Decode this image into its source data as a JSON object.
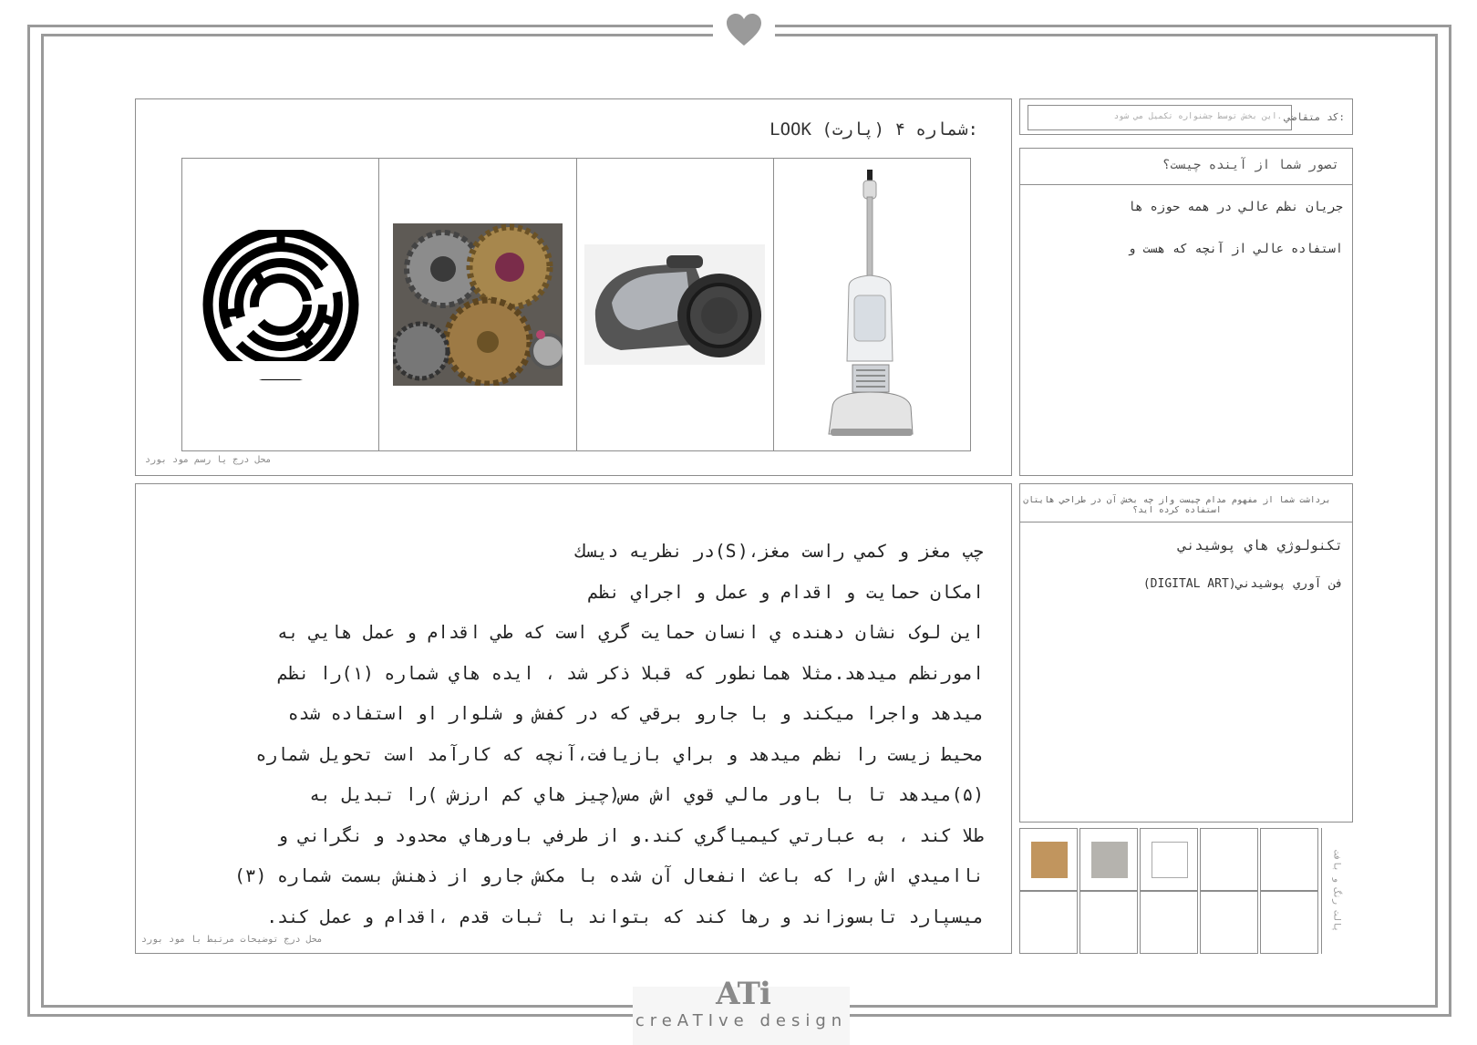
{
  "look_board": {
    "title": "LOOK (پارت) شماره ۴:",
    "note": "محل درج يا رسم مود بورد",
    "images": [
      {
        "name": "maze"
      },
      {
        "name": "gears"
      },
      {
        "name": "canister-vacuum"
      },
      {
        "name": "upright-vacuum"
      }
    ]
  },
  "description": {
    "lines": [
      "چپ مغز و كمي راست مغز،(S)در نظريه ديسك",
      "امكان حمايت و اقدام و عمل و اجراي نظم",
      "اين لوک نشان دهنده ي انسان حمايت گري است كه طي اقدام و عمل هايي به",
      "امورنظم ميدهد.مثلا همانطور كه قبلا ذكر شد ، ايده هاي شماره (١)را نظم",
      "ميدهد واجرا ميكند و با جارو برقي كه در كفش و شلوار او استفاده شده",
      "محيط زيست را نظم ميدهد و براي بازيافت،آنچه كه كارآمد است تحويل شماره",
      "(۵)ميدهد تا با باور مالي قوي اش مس(چيز هاي كم ارزش )را تبديل به",
      "طلا كند ، به عبارتي كيمياگري كند.و از طرفي باورهاي محدود و نگراني و",
      "نااميدي اش را كه باعث انفعال آن شده با مكش جارو از ذهنش بسمت شماره (٣)",
      "ميسپارد تابسوزاند و رها كند كه بتواند با ثبات قدم ،اقدام و عمل كند."
    ],
    "note": "محل درج توضيحات مرتبط با مود بورد"
  },
  "applicant": {
    "label": ":كد متقاضي",
    "placeholder": ".اين بخش توسط جشنواره تكميل مي شود"
  },
  "future": {
    "question": "تصور شما از آينده چيست؟",
    "answers": [
      "جريان نظم عالي در همه حوزه ها",
      "استفاده عالي از آنچه كه هست و"
    ]
  },
  "perception": {
    "question": "برداشت شما از مفهوم مدام چيست واز چه بخش آن در طراحي هايتان استفاده كرده ايد؟",
    "answers": [
      "تكنولوژي هاي پوشيدني",
      "فن آوري پوشيدني(DIGITAL ART)"
    ]
  },
  "palette": {
    "label": "پالت رنگ و بافت",
    "colors": [
      "#c1955e",
      "#b5b3ae",
      "#ffffff"
    ]
  },
  "branding": {
    "logo": "ATi",
    "tagline": "creATIve design"
  }
}
